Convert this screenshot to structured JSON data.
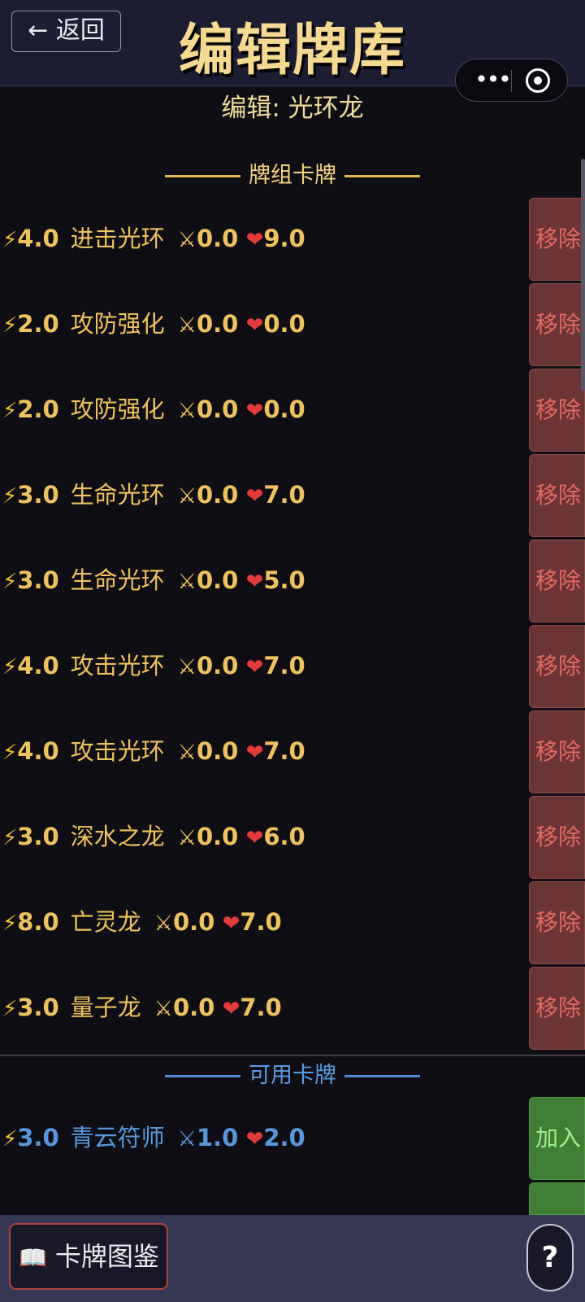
{
  "header": {
    "back_label": "← 返回",
    "title": "编辑牌库",
    "subtitle": "编辑: 光环龙",
    "capsule_more": "•••"
  },
  "deck_section": {
    "title": "牌组卡牌",
    "button_label": "移除",
    "cards": [
      {
        "cost": "4.0",
        "name": "进击光环",
        "atk": "0.0",
        "hp": "9.0"
      },
      {
        "cost": "2.0",
        "name": "攻防强化",
        "atk": "0.0",
        "hp": "0.0"
      },
      {
        "cost": "2.0",
        "name": "攻防强化",
        "atk": "0.0",
        "hp": "0.0"
      },
      {
        "cost": "3.0",
        "name": "生命光环",
        "atk": "0.0",
        "hp": "7.0"
      },
      {
        "cost": "3.0",
        "name": "生命光环",
        "atk": "0.0",
        "hp": "5.0"
      },
      {
        "cost": "4.0",
        "name": "攻击光环",
        "atk": "0.0",
        "hp": "7.0"
      },
      {
        "cost": "4.0",
        "name": "攻击光环",
        "atk": "0.0",
        "hp": "7.0"
      },
      {
        "cost": "3.0",
        "name": "深水之龙",
        "atk": "0.0",
        "hp": "6.0"
      },
      {
        "cost": "8.0",
        "name": "亡灵龙",
        "atk": "0.0",
        "hp": "7.0"
      },
      {
        "cost": "3.0",
        "name": "量子龙",
        "atk": "0.0",
        "hp": "7.0"
      }
    ]
  },
  "available_section": {
    "title": "可用卡牌",
    "button_label": "加入",
    "cards": [
      {
        "cost": "3.0",
        "name": "青云符师",
        "atk": "1.0",
        "hp": "2.0"
      }
    ]
  },
  "icons": {
    "cost": "⚡",
    "attack": "⚔",
    "health": "❤",
    "book": "📖"
  },
  "bottom_bar": {
    "book_label": "卡牌图鉴",
    "help_label": "?"
  },
  "colors": {
    "deck_text": "#efc35c",
    "available_text": "#5798dd",
    "remove_button": "#6b3535",
    "add_button": "#3e7f33",
    "title": "#f5d98f"
  }
}
